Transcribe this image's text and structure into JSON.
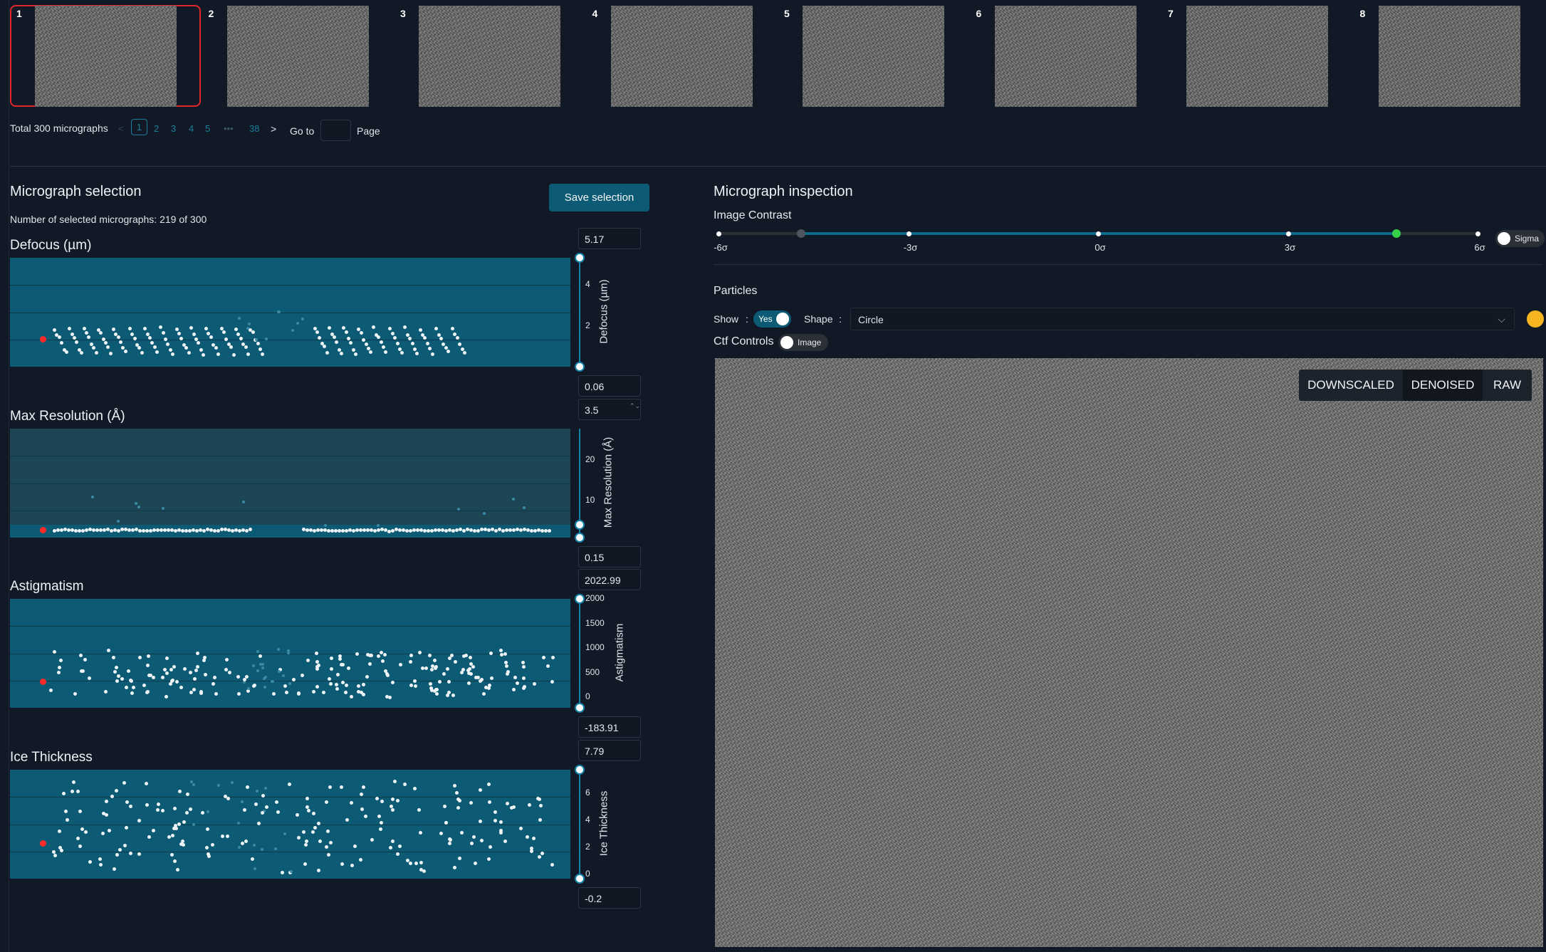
{
  "thumbnails": [
    {
      "number": "1",
      "selected": true
    },
    {
      "number": "2",
      "selected": false
    },
    {
      "number": "3",
      "selected": false
    },
    {
      "number": "4",
      "selected": false
    },
    {
      "number": "5",
      "selected": false
    },
    {
      "number": "6",
      "selected": false
    },
    {
      "number": "7",
      "selected": false
    },
    {
      "number": "8",
      "selected": false
    }
  ],
  "pagination": {
    "total": "Total 300 micrographs",
    "prev": "<",
    "pages": [
      "1",
      "2",
      "3",
      "4",
      "5"
    ],
    "current": "1",
    "ellipsis": "•••",
    "last": "38",
    "next": ">",
    "goto_label": "Go to",
    "goto_value": "",
    "page_label": "Page"
  },
  "selection": {
    "title": "Micrograph selection",
    "save_label": "Save selection",
    "count_text": "Number of selected micrographs: 219 of 300",
    "charts": [
      {
        "title": "Defocus (µm)",
        "axis_title": "Defocus (µm)",
        "upper_value": "5.17",
        "lower_value": "0.06",
        "ticks": [
          "4",
          "2"
        ],
        "ylim": [
          0.06,
          5.17
        ]
      },
      {
        "title": "Max Resolution (Å)",
        "axis_title": "Max Resolution (Å)",
        "upper_value": "3.5",
        "lower_value": "0.15",
        "ticks": [
          "20",
          "10"
        ],
        "ylim": [
          0.15,
          27
        ]
      },
      {
        "title": "Astigmatism",
        "axis_title": "Astigmatism",
        "upper_value": "2022.99",
        "lower_value": "-183.91",
        "ticks": [
          "2000",
          "1500",
          "1000",
          "500",
          "0"
        ],
        "ylim": [
          -183.91,
          2022.99
        ]
      },
      {
        "title": "Ice Thickness",
        "axis_title": "Ice Thickness",
        "upper_value": "7.79",
        "lower_value": "-0.2",
        "ticks": [
          "6",
          "4",
          "2",
          "0"
        ],
        "ylim": [
          -0.2,
          7.79
        ]
      }
    ]
  },
  "inspection": {
    "title": "Micrograph inspection",
    "contrast_label": "Image Contrast",
    "contrast_ticks": [
      "-6σ",
      "-3σ",
      "0σ",
      "3σ",
      "6σ"
    ],
    "contrast_range": [
      -4.7,
      4.7
    ],
    "sigma_label": "Sigma",
    "particles_label": "Particles",
    "show_label": "Show",
    "colon": ":",
    "show_toggle": "Yes",
    "shape_label": "Shape",
    "shape_value": "Circle",
    "particle_color": "#f5b521",
    "ctf_label": "Ctf Controls",
    "ctf_toggle": "Image",
    "view_modes": [
      "DOWNSCALED",
      "DENOISED",
      "RAW"
    ],
    "active_mode": "DENOISED"
  },
  "colors": {
    "panel": "#0c5a74",
    "accent": "#1582a8",
    "selected_border": "#e0262a",
    "highlight_point": "#ff2a2a",
    "save_button": "#0c5a74"
  }
}
